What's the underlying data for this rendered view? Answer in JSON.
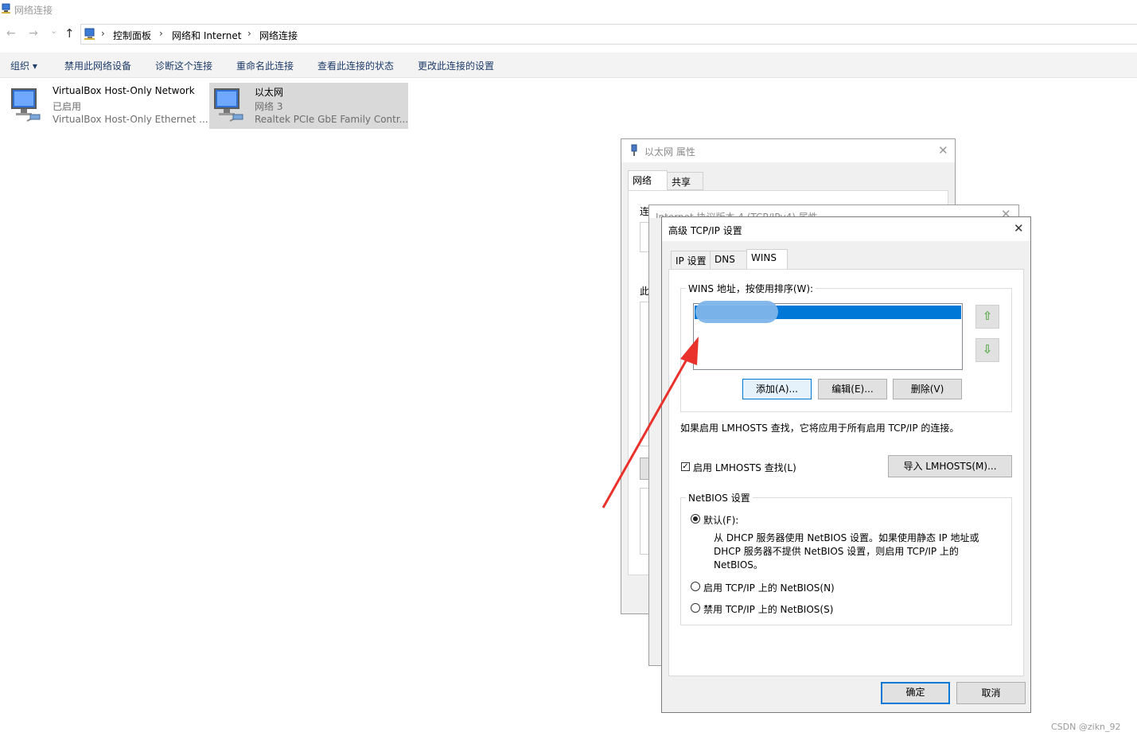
{
  "window": {
    "title": "网络连接"
  },
  "address": {
    "crumbs": [
      "控制面板",
      "网络和 Internet",
      "网络连接"
    ],
    "separator": "›"
  },
  "nav": {
    "back": "←",
    "forward": "→",
    "dropdown": "⌄",
    "up": "↑"
  },
  "commands": {
    "organize": "组织",
    "organize_arrow": "▾",
    "disable": "禁用此网络设备",
    "diagnose": "诊断这个连接",
    "rename": "重命名此连接",
    "status": "查看此连接的状态",
    "settings": "更改此连接的设置"
  },
  "connections": [
    {
      "name": "VirtualBox Host-Only Network",
      "status": "已启用",
      "adapter": "VirtualBox Host-Only Ethernet ..."
    },
    {
      "name": "以太网",
      "status": "网络 3",
      "adapter": "Realtek PCIe GbE Family Contr..."
    }
  ],
  "eth_props": {
    "title": "以太网 属性",
    "tabs": [
      "网络",
      "共享"
    ],
    "partial_label_connect": "连",
    "partial_label_this": "此"
  },
  "ipv4_props": {
    "title": "Internet 协议版本 4 (TCP/IPv4) 属性"
  },
  "adv": {
    "title": "高级 TCP/IP 设置",
    "tabs": [
      "IP 设置",
      "DNS",
      "WINS"
    ],
    "wins_group_label": "WINS 地址，按使用排序(W):",
    "add": "添加(A)...",
    "edit": "编辑(E)...",
    "delete": "删除(V)",
    "lmhosts_note": "如果启用 LMHOSTS 查找，它将应用于所有启用 TCP/IP 的连接。",
    "enable_lmhosts": "启用 LMHOSTS 查找(L)",
    "enable_lmhosts_checked": true,
    "import_lmhosts": "导入 LMHOSTS(M)...",
    "netbios_group_label": "NetBIOS 设置",
    "radio_default": "默认(F):",
    "radio_default_desc": [
      "从 DHCP 服务器使用 NetBIOS 设置。如果使用静态 IP 地址或",
      "DHCP 服务器不提供 NetBIOS 设置，则启用 TCP/IP 上的",
      "NetBIOS。"
    ],
    "radio_enable": "启用 TCP/IP 上的 NetBIOS(N)",
    "radio_disable": "禁用 TCP/IP 上的 NetBIOS(S)",
    "selected_radio": "default",
    "ok": "确定",
    "cancel": "取消",
    "close": "✕",
    "up_arrow": "⇧",
    "down_arrow": "⇩"
  },
  "watermark": "CSDN @zikn_92",
  "colors": {
    "selection_blue": "#0078d7",
    "annotation_red": "#e8322b",
    "command_text": "#1e3c6a"
  }
}
